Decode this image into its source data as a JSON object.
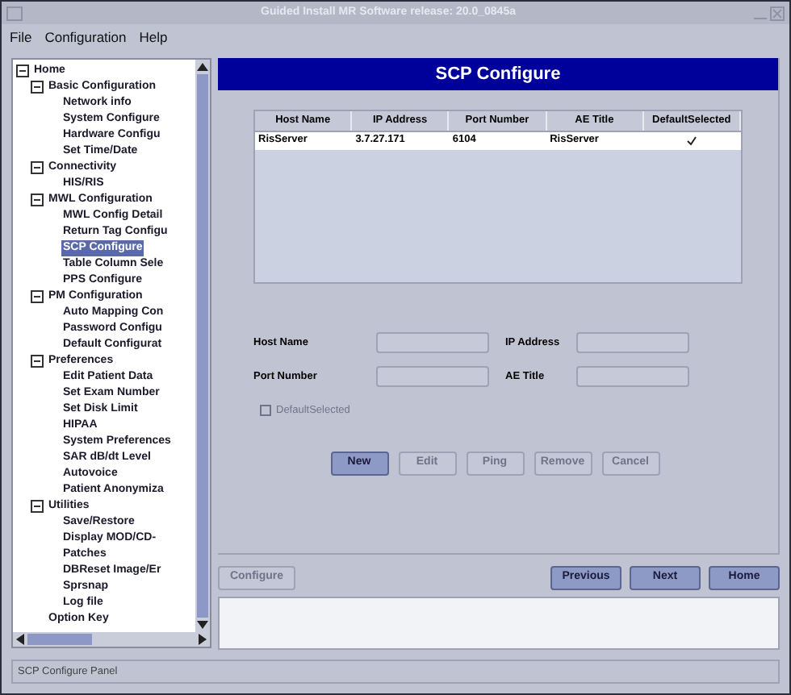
{
  "window": {
    "title": "Guided Install  MR Software release: 20.0_0845a"
  },
  "menu": [
    "File",
    "Configuration",
    "Help"
  ],
  "tree": [
    {
      "label": "Home",
      "expanded": true,
      "selected": false,
      "children": [
        {
          "label": "Basic Configuration",
          "expanded": true,
          "selected": false,
          "children": [
            {
              "label": "Network info",
              "selected": false
            },
            {
              "label": "System Configure",
              "selected": false
            },
            {
              "label": "Hardware Configu",
              "selected": false
            },
            {
              "label": "Set Time/Date",
              "selected": false
            }
          ]
        },
        {
          "label": "Connectivity",
          "expanded": true,
          "selected": false,
          "children": [
            {
              "label": "HIS/RIS",
              "selected": false
            }
          ]
        },
        {
          "label": "MWL Configuration",
          "expanded": true,
          "selected": false,
          "children": [
            {
              "label": "MWL Config Detail",
              "selected": false
            },
            {
              "label": "Return Tag Configu",
              "selected": false
            },
            {
              "label": "SCP Configure",
              "selected": true
            },
            {
              "label": "Table Column Sele",
              "selected": false
            },
            {
              "label": "PPS Configure",
              "selected": false
            }
          ]
        },
        {
          "label": "PM Configuration",
          "expanded": true,
          "selected": false,
          "children": [
            {
              "label": "Auto Mapping Con",
              "selected": false
            },
            {
              "label": "Password Configu",
              "selected": false
            },
            {
              "label": "Default Configurat",
              "selected": false
            }
          ]
        },
        {
          "label": "Preferences",
          "expanded": true,
          "selected": false,
          "children": [
            {
              "label": "Edit Patient Data",
              "selected": false
            },
            {
              "label": "Set Exam Number",
              "selected": false
            },
            {
              "label": "Set Disk Limit",
              "selected": false
            },
            {
              "label": "HIPAA",
              "selected": false
            },
            {
              "label": "System Preferences",
              "selected": false
            },
            {
              "label": "SAR dB/dt Level",
              "selected": false
            },
            {
              "label": "Autovoice",
              "selected": false
            },
            {
              "label": "Patient Anonymiza",
              "selected": false
            }
          ]
        },
        {
          "label": "Utilities",
          "expanded": true,
          "selected": false,
          "children": [
            {
              "label": "Save/Restore",
              "selected": false
            },
            {
              "label": "Display MOD/CD-",
              "selected": false
            },
            {
              "label": "Patches",
              "selected": false
            },
            {
              "label": "DBReset Image/Er",
              "selected": false
            },
            {
              "label": "Sprsnap",
              "selected": false
            },
            {
              "label": "Log file",
              "selected": false
            }
          ]
        },
        {
          "label": "Option Key",
          "selected": false
        }
      ]
    }
  ],
  "panel": {
    "title": "SCP Configure",
    "table": {
      "columns": [
        "Host Name",
        "IP Address",
        "Port Number",
        "AE Title",
        "DefaultSelected"
      ],
      "rows": [
        {
          "host": "RisServer",
          "ip": "3.7.27.171",
          "port": "6104",
          "ae": "RisServer",
          "default_selected": true
        }
      ]
    },
    "fields": [
      {
        "label": "Host Name"
      },
      {
        "label": "IP Address"
      },
      {
        "label": "Port Number"
      },
      {
        "label": "AE Title"
      }
    ],
    "checkbox": {
      "label": "DefaultSelected",
      "checked": false,
      "disabled": true
    },
    "buttons": [
      {
        "label": "New",
        "disabled": false
      },
      {
        "label": "Edit",
        "disabled": true
      },
      {
        "label": "Ping",
        "disabled": true
      },
      {
        "label": "Remove",
        "disabled": true
      },
      {
        "label": "Cancel",
        "disabled": true
      }
    ]
  },
  "nav": {
    "configure": {
      "label": "Configure",
      "disabled": true
    },
    "buttons": [
      {
        "label": "Previous",
        "disabled": false
      },
      {
        "label": "Next",
        "disabled": false
      },
      {
        "label": "Home",
        "disabled": false
      }
    ]
  },
  "status_bar": "SCP Configure Panel"
}
